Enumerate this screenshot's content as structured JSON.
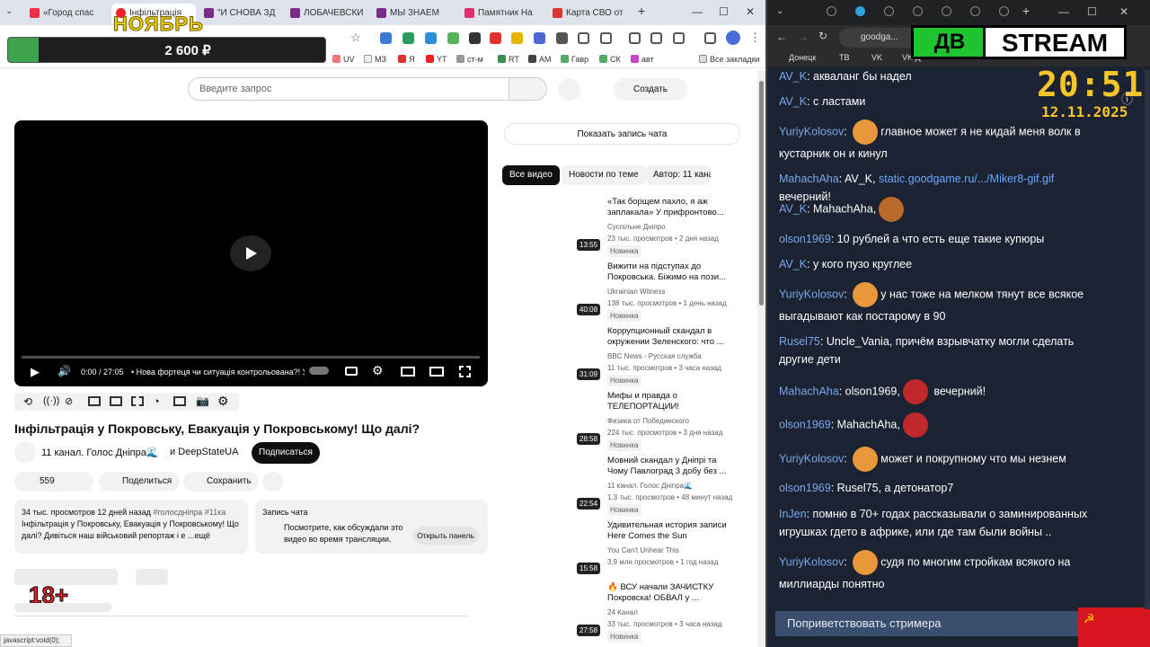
{
  "left_browser": {
    "tabs": [
      "«Город спас",
      "Інфільтрація",
      "\"И СНОВА ЗД",
      "ЛОБАЧЕВСКИ",
      "МЫ ЗНАЕМ",
      "Памятник На",
      "Карта СВО от"
    ],
    "tab_new": "+",
    "win_min": "—",
    "win_max": "☐",
    "win_close": "✕",
    "bookmarks": [
      "UV",
      "МЗ",
      "Я",
      "YT",
      "ст-м",
      "RT",
      "AM",
      "Гавр",
      "СК",
      "авт"
    ],
    "all_bookmarks": "Все закладки",
    "status_url": "javascript:void(0);"
  },
  "overlay": {
    "month": "НОЯБРЬ",
    "amount": "2 600 ₽",
    "age": "18+"
  },
  "youtube": {
    "search_placeholder": "Введите запрос",
    "create": "Создать",
    "player": {
      "time": "0:00 / 27:05",
      "chapter": "• Нова фортеця чи ситуація контрольована?! У П"
    },
    "title": "Інфільтрація у Покровську, Евакуація у Покровському! Що далі?",
    "channel": "11 канал. Голос Дніпра🌊",
    "channel2": "и DeepStateUA",
    "subscribe": "Подписаться",
    "likes": "559",
    "share": "Поделиться",
    "save": "Сохранить",
    "desc_meta": "34 тыс. просмотров  12 дней назад",
    "desc_tags": "#голосдніпра #11ка",
    "desc_text": "Інфільтрація у Покровську, Евакуація у Покровському! Що далі? Дивіться наш військовий  репортаж і е",
    "desc_more": "...ещё",
    "chat_title": "Запись чата",
    "chat_text": "Посмотрите, как обсуждали это видео во время трансляции.",
    "chat_open": "Открыть панель",
    "show_chat": "Показать запись чата",
    "chips": [
      "Все видео",
      "Новости по теме",
      "Автор: 11 канал"
    ],
    "recs": [
      {
        "title": "«Так борщем пахло, я аж заплакала» У прифронтово...",
        "channel": "Суспільне Дніпро",
        "meta": "23 тыс. просмотров • 2 дня назад",
        "badge": "Новинка",
        "dur": "13:55"
      },
      {
        "title": "Вижити на підступах до Покровська. Біжимо на пози...",
        "channel": "Ukrainian Witness",
        "meta": "138 тыс. просмотров • 1 день назад",
        "badge": "Новинка",
        "dur": "40:08"
      },
      {
        "title": "Коррупционный скандал в окружении Зеленского: что ...",
        "channel": "BBC News - Русская служба",
        "meta": "11 тыс. просмотров • 3 часа назад",
        "badge": "Новинка",
        "dur": "31:09"
      },
      {
        "title": "Мифы и правда о ТЕЛЕПОРТАЦИИ!",
        "channel": "Физика от Побединского",
        "meta": "224 тыс. просмотров • 3 дня назад",
        "badge": "Новинка",
        "dur": "28:58"
      },
      {
        "title": "Мовний скандал у Дніпрі та Чому Павлоград 3 добу без ...",
        "channel": "11 канал. Голос Дніпра🌊",
        "meta": "1,3 тыс. просмотров • 48 минут назад",
        "badge": "Новинка",
        "dur": "22:54"
      },
      {
        "title": "Удивительная история записи Here Comes the Sun",
        "channel": "You Can't Unhear This",
        "meta": "3,9 млн просмотров • 1 год назад",
        "badge": "",
        "dur": "15:58"
      },
      {
        "title": "🔥 ВСУ начали ЗАЧИСТКУ Покровска! ОБВАЛ у ...",
        "channel": "24 Канал",
        "meta": "33 тыс. просмотров • 3 часа назад",
        "badge": "Новинка",
        "dur": "27:58"
      }
    ]
  },
  "right_browser": {
    "addr": "goodga...",
    "bookmarks": [
      "Донецк",
      "ТВ",
      "VK",
      "VK Д"
    ],
    "stream_logo": "STREAM",
    "clock": "20:51",
    "date": "12.11.2025",
    "messages": [
      {
        "user": "AV_K",
        "text": "акваланг бы надел"
      },
      {
        "user": "AV_K",
        "text": "с ластами"
      },
      {
        "user": "YuriyKolosov",
        "text": "главное может я не кидай меня волк в кустарник он и кинул"
      },
      {
        "user": "MahachAha",
        "pre": "AV_K,",
        "link": "static.goodgame.ru/.../Miker8-gif.gif",
        "text": "вечерний!"
      },
      {
        "user": "AV_K",
        "text": "MahachAha,"
      },
      {
        "user": "olson1969",
        "text": "10 рублей а что есть еще такие купюры"
      },
      {
        "user": "AV_K",
        "text": "у кого пузо круглее"
      },
      {
        "user": "YuriyKolosov",
        "text": "у нас тоже на мелком тянут все всякое выгадывают как постарому в 90"
      },
      {
        "user": "Rusel75",
        "text": "Uncle_Vania, причём взрывчатку могли сделать другие дети"
      },
      {
        "user": "MahachAha",
        "text": "olson1969,",
        "text2": "вечерний!"
      },
      {
        "user": "olson1969",
        "text": "MahachAha,"
      },
      {
        "user": "YuriyKolosov",
        "text": "может и покрупному что мы незнем"
      },
      {
        "user": "olson1969",
        "text": "Rusel75, а детонатор7"
      },
      {
        "user": "InJen",
        "text": "помню в 70+ годах рассказывали о заминированных игрушках гдето в африке, или где там были войны .."
      },
      {
        "user": "YuriyKolosov",
        "text": "судя по многим стройкам всякого на миллиарды понятно"
      }
    ],
    "greet": "Поприветствовать стримера"
  }
}
